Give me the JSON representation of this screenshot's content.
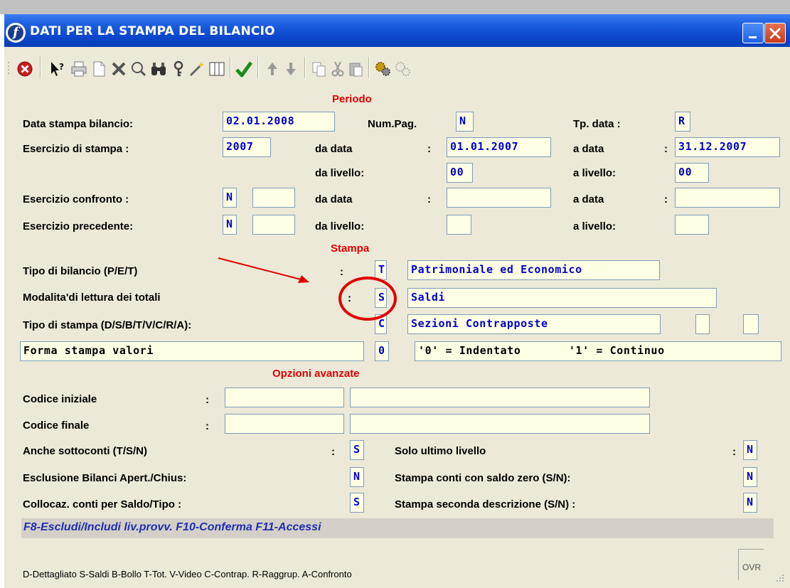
{
  "window": {
    "title": "DATI PER LA STAMPA DEL BILANCIO"
  },
  "sections": {
    "periodo": "Periodo",
    "stampa": "Stampa",
    "opzioni": "Opzioni avanzate"
  },
  "periodo": {
    "data_stampa_label": "Data stampa bilancio:",
    "data_stampa_value": "02.01.2008",
    "num_pag_label": "Num.Pag.",
    "num_pag_value": "N",
    "tp_data_label": "Tp. data :",
    "tp_data_value": "R",
    "esercizio_label": "Esercizio di stampa :",
    "esercizio_value": "2007",
    "da_data_label": "da data",
    "da_data_value": "01.01.2007",
    "a_data_label": "a data",
    "a_data_value": "31.12.2007",
    "da_livello_label": "da livello:",
    "da_livello_value": "00",
    "a_livello_label": "a livello:",
    "a_livello_value": "00",
    "confronto_label": "Esercizio confronto :",
    "confronto_flag": "N",
    "confronto_da_data_label": "da data",
    "confronto_a_data_label": "a data",
    "precedente_label": "Esercizio precedente:",
    "precedente_flag": "N",
    "precedente_da_livello_label": "da livello:",
    "precedente_a_livello_label": "a livello:"
  },
  "stampa": {
    "tipo_bilancio_label": "Tipo di bilancio (P/E/T)",
    "tipo_bilancio_code": "T",
    "tipo_bilancio_desc": "Patrimoniale ed Economico",
    "modalita_label": "Modalita'di lettura dei totali",
    "modalita_code": "S",
    "modalita_desc": "Saldi",
    "tipo_stampa_label": "Tipo di stampa (D/S/B/T/V/C/R/A):",
    "tipo_stampa_code": "C",
    "tipo_stampa_desc": "Sezioni Contrapposte",
    "forma_label": "Forma stampa valori",
    "forma_code": "0",
    "forma_desc": "'0' = Indentato       '1' = Continuo"
  },
  "opzioni": {
    "codice_iniziale_label": "Codice iniziale",
    "codice_finale_label": "Codice finale",
    "sottoconti_label": "Anche sottoconti (T/S/N)",
    "sottoconti_value": "S",
    "ultimo_livello_label": "Solo ultimo livello",
    "ultimo_livello_value": "N",
    "esclusione_label": "Esclusione Bilanci Apert./Chius:",
    "esclusione_value": "N",
    "saldo_zero_label": "Stampa conti con saldo zero (S/N):",
    "saldo_zero_value": "N",
    "collocaz_label": "Collocaz. conti per Saldo/Tipo :",
    "collocaz_value": "S",
    "seconda_desc_label": "Stampa seconda descrizione (S/N) :",
    "seconda_desc_value": "N"
  },
  "fkeys": "F8-Escludi/Includi liv.provv. F10-Conferma F11-Accessi",
  "status": {
    "legend": "D-Dettagliato S-Saldi B-Bollo T-Tot. V-Video C-Contrap. R-Raggrup. A-Confronto",
    "ovr": "OVR"
  },
  "colors": {
    "title_blue": "#0b44c8",
    "section_red": "#e00000",
    "field_blue": "#0000cc",
    "field_bg": "#ffffe6"
  },
  "toolbar_icons": [
    "exit-icon",
    "help-icon",
    "print-icon",
    "new-icon",
    "delete-icon",
    "search-icon",
    "binoculars-icon",
    "key-icon",
    "wand-icon",
    "columns-icon",
    "confirm-check-icon",
    "arrow-up-icon",
    "arrow-down-icon",
    "copy-icon",
    "cut-icon",
    "paste-icon",
    "gears-icon",
    "gears-disabled-icon"
  ]
}
